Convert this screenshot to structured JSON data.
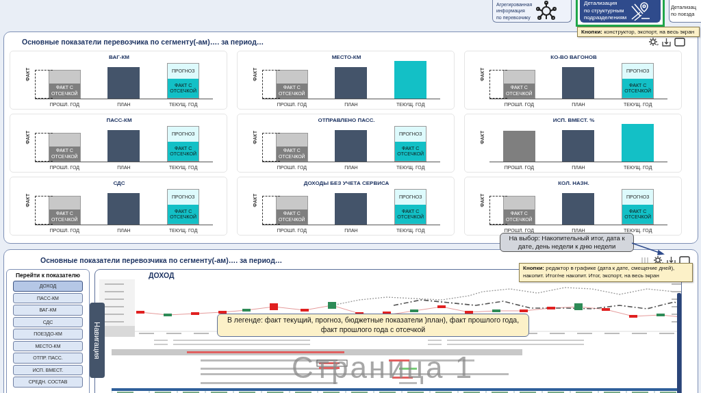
{
  "header_buttons": [
    {
      "lines": [
        "Агрегированная",
        "информация",
        "по перевозчику"
      ],
      "selected": false
    },
    {
      "lines": [
        "Детализация",
        "по структурным",
        "подразделениям"
      ],
      "selected": true
    },
    {
      "lines": [
        "Детализац",
        "по поезда"
      ],
      "selected": false
    }
  ],
  "header_tooltip": "**Кнопки:** конструктор, экспорт, на весь экран",
  "summary_panel": {
    "title": "Основные показатели перевозчика по сегменту(-ам)…. за период…",
    "toolbar": [
      {
        "kind": "settings"
      },
      {
        "kind": "download"
      },
      {
        "kind": "fullscreen"
      }
    ],
    "cards": [
      {
        "title": "ВАГ-КМ",
        "axis_label": "ФАКТ",
        "bars": [
          {
            "kind": "past",
            "label": "ПРОШЛ. ГОД",
            "fact_text": "ФАКТ С ОТСЕЧКОЙ"
          },
          {
            "kind": "plan",
            "label": "ПЛАН"
          },
          {
            "kind": "current_split",
            "label": "ТЕКУЩ. ГОД",
            "forecast_text": "ПРОГНОЗ",
            "fact_text": "ФАКТ С ОТСЕЧКОЙ"
          }
        ]
      },
      {
        "title": "МЕСТО-КМ",
        "axis_label": "ФАКТ",
        "bars": [
          {
            "kind": "past",
            "label": "ПРОШЛ. ГОД",
            "fact_text": "ФАКТ С ОТСЕЧКОЙ"
          },
          {
            "kind": "plan",
            "label": "ПЛАН"
          },
          {
            "kind": "current_solid",
            "label": "ТЕКУЩ. ГОД"
          }
        ]
      },
      {
        "title": "КО-ВО ВАГОНОВ",
        "axis_label": "ФАКТ",
        "bars": [
          {
            "kind": "past",
            "label": "ПРОШЛ. ГОД",
            "fact_text": "ФАКТ С ОТСЕЧКОЙ"
          },
          {
            "kind": "plan",
            "label": "ПЛАН"
          },
          {
            "kind": "current_split",
            "label": "ТЕКУЩ. ГОД",
            "forecast_text": "ПРОГНОЗ",
            "fact_text": "ФАКТ С ОТСЕЧКОЙ"
          }
        ]
      },
      {
        "title": "ПАСС-КМ",
        "axis_label": "ФАКТ",
        "bars": [
          {
            "kind": "past",
            "label": "ПРОШЛ. ГОД",
            "fact_text": "ФАКТ С ОТСЕЧКОЙ"
          },
          {
            "kind": "plan",
            "label": "ПЛАН"
          },
          {
            "kind": "current_split",
            "label": "ТЕКУЩ. ГОД",
            "forecast_text": "ПРОГНОЗ",
            "fact_text": "ФАКТ С ОТСЕЧКОЙ"
          }
        ]
      },
      {
        "title": "ОТПРАВЛЕНО ПАСС.",
        "axis_label": "ФАКТ",
        "bars": [
          {
            "kind": "past",
            "label": "ПРОШЛ. ГОД",
            "fact_text": "ФАКТ С ОТСЕЧКОЙ"
          },
          {
            "kind": "plan",
            "label": "ПЛАН"
          },
          {
            "kind": "current_split",
            "label": "ТЕКУЩ. ГОД",
            "forecast_text": "ПРОГНОЗ",
            "fact_text": "ФАКТ С ОТСЕЧКОЙ"
          }
        ]
      },
      {
        "title": "ИСП. ВМЕСТ. %",
        "axis_label": "ФАКТ",
        "bars": [
          {
            "kind": "past_solid",
            "label": "ПРОШЛ. ГОД"
          },
          {
            "kind": "plan",
            "label": "ПЛАН"
          },
          {
            "kind": "current_solid",
            "label": "ТЕКУЩ. ГОД"
          }
        ]
      },
      {
        "title": "СДС",
        "axis_label": "ФАКТ",
        "bars": [
          {
            "kind": "past",
            "label": "ПРОШЛ. ГОД",
            "fact_text": "ФАКТ С ОТСЕЧКОЙ"
          },
          {
            "kind": "plan",
            "label": "ПЛАН"
          },
          {
            "kind": "current_split",
            "label": "ТЕКУЩ. ГОД",
            "forecast_text": "ПРОГНОЗ",
            "fact_text": "ФАКТ С ОТСЕЧКОЙ"
          }
        ]
      },
      {
        "title": "ДОХОДЫ БЕЗ УЧЕТА СЕРВИСА",
        "axis_label": "ФАКТ",
        "bars": [
          {
            "kind": "past",
            "label": "ПРОШЛ. ГОД",
            "fact_text": "ФАКТ С ОТСЕЧКОЙ"
          },
          {
            "kind": "plan",
            "label": "ПЛАН"
          },
          {
            "kind": "current_split",
            "label": "ТЕКУЩ. ГОД",
            "forecast_text": "ПРОГНОЗ",
            "fact_text": "ФАКТ С ОТСЕЧКОЙ"
          }
        ]
      },
      {
        "title": "КОЛ. НАЗН.",
        "axis_label": "ФАКТ",
        "bars": [
          {
            "kind": "past",
            "label": "ПРОШЛ. ГОД",
            "fact_text": "ФАКТ С ОТСЕЧКОЙ"
          },
          {
            "kind": "plan",
            "label": "ПЛАН"
          },
          {
            "kind": "current_split",
            "label": "ТЕКУЩ. ГОД",
            "forecast_text": "ПРОГНОЗ",
            "fact_text": "ФАКТ С ОТСЕЧКОЙ"
          }
        ]
      }
    ]
  },
  "mode_callout": "На выбор: Накопительный итог, дата к дате, день недели к дню недели",
  "detail_panel": {
    "title": "Основные показатели перевозчика по сегменту(-ам)…. за период…",
    "toolbar": [
      {
        "kind": "columns"
      },
      {
        "kind": "settings"
      },
      {
        "kind": "download"
      },
      {
        "kind": "fullscreen"
      }
    ],
    "tooltip": "**Кнопки:** редактор в графике (дата к дате, смещение дней), накопит. Итог/не накопит. Итог, экспорт, на весь экран",
    "nav": {
      "title": "Перейти к показателю",
      "items": [
        {
          "label": "ДОХОД",
          "selected": true
        },
        {
          "label": "ПАСС-КМ",
          "selected": false
        },
        {
          "label": "ВАГ-КМ",
          "selected": false
        },
        {
          "label": "СДС",
          "selected": false
        },
        {
          "label": "ПОЕЗДО-КМ",
          "selected": false
        },
        {
          "label": "МЕСТО-КМ",
          "selected": false
        },
        {
          "label": "ОТПР. ПАСС.",
          "selected": false
        },
        {
          "label": "ИСП. ВМЕСТ.",
          "selected": false
        },
        {
          "label": "СРЕДН. СОСТАВ",
          "selected": false
        }
      ]
    },
    "nav_tab": "Навигация",
    "report": {
      "title": "ДОХОД",
      "page_label": "Страница 1",
      "legend_note": "В легенде: факт текущий, прогноз, бюджетные показатели )план), факт прошлого года, факт прошлого года с отсечкой"
    }
  }
}
